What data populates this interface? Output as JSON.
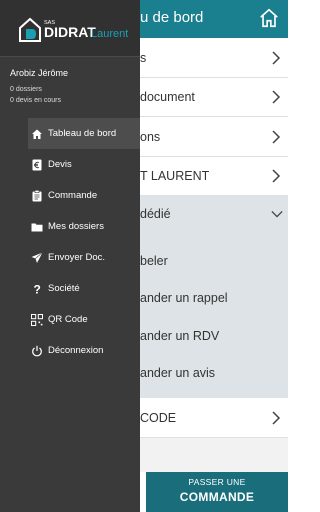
{
  "header": {
    "title": "u de bord"
  },
  "content_rows": [
    {
      "label": "s"
    },
    {
      "label": "document"
    },
    {
      "label": "ons"
    },
    {
      "label": "T LAURENT"
    }
  ],
  "dedicated_section": {
    "label": "dédié",
    "items": [
      {
        "label": "beler"
      },
      {
        "label": "ander un rappel"
      },
      {
        "label": "ander un RDV"
      },
      {
        "label": "ander un avis"
      }
    ]
  },
  "qr_row": {
    "label": "CODE"
  },
  "order_button": {
    "line1": "PASSER UNE",
    "line2": "COMMANDE"
  },
  "brand": {
    "prefix": "SAS",
    "name": "DIDRAT",
    "suffix": "Laurent"
  },
  "user": {
    "name": "Arobiz Jérôme",
    "dossiers": "0 dossiers",
    "devis": "0 devis en cours"
  },
  "menu": [
    {
      "label": "Tableau de bord",
      "icon": "home-icon"
    },
    {
      "label": "Devis",
      "icon": "euro-document-icon"
    },
    {
      "label": "Commande",
      "icon": "clipboard-icon"
    },
    {
      "label": "Mes dossiers",
      "icon": "folder-icon"
    },
    {
      "label": "Envoyer Doc.",
      "icon": "paper-plane-icon"
    },
    {
      "label": "Société",
      "icon": "question-icon"
    },
    {
      "label": "QR Code",
      "icon": "qr-code-icon"
    },
    {
      "label": "Déconnexion",
      "icon": "power-icon"
    }
  ],
  "colors": {
    "teal": "#1a7f8e",
    "button": "#1a6e7c",
    "drawer": "#3a3a3a"
  }
}
